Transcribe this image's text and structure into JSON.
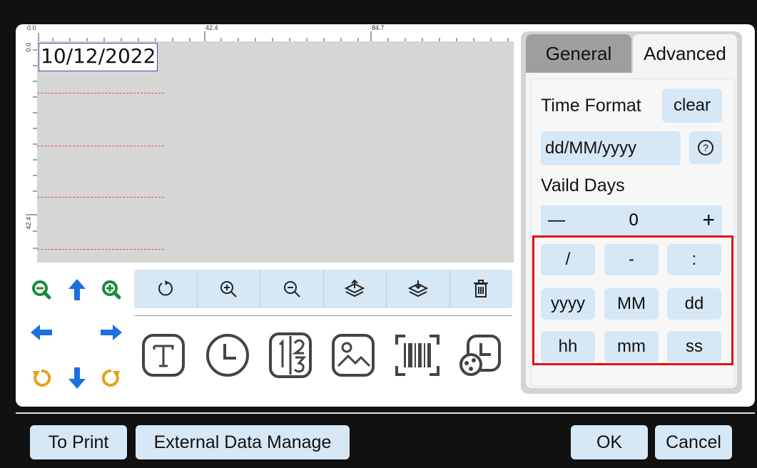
{
  "canvas": {
    "ruler_top_labels": [
      "0.0",
      "42.4",
      "84.7"
    ],
    "ruler_left_labels": [
      "0.0",
      "42.4"
    ],
    "date_text": "10/12/2022"
  },
  "toolbar": {
    "icons": [
      "rotate-icon",
      "zoom-in-icon",
      "zoom-out-icon",
      "layer-up-icon",
      "layer-down-icon",
      "trash-icon"
    ]
  },
  "navigation": {
    "icons": [
      "zoom-out-icon",
      "arrow-up-icon",
      "zoom-in-icon",
      "arrow-left-icon",
      "arrow-right-icon",
      "rotate-left-icon",
      "arrow-down-icon",
      "rotate-right-icon"
    ]
  },
  "insert_tools": {
    "icons": [
      "text-tool-icon",
      "clock-tool-icon",
      "counter-tool-icon",
      "image-tool-icon",
      "barcode-tool-icon",
      "shift-tool-icon"
    ]
  },
  "tabs": {
    "general": "General",
    "advanced": "Advanced"
  },
  "advanced": {
    "time_format_label": "Time Format",
    "clear_label": "clear",
    "format_value": "dd/MM/yyyy",
    "help_icon": "?",
    "valid_days_label": "Vaild Days",
    "valid_days_value": "0",
    "minus": "—",
    "plus": "+",
    "symbols": [
      "/",
      "-",
      ":",
      "yyyy",
      "MM",
      "dd",
      "hh",
      "mm",
      "ss"
    ]
  },
  "bottom": {
    "to_print": "To Print",
    "external_data": "External Data Manage",
    "ok": "OK",
    "cancel": "Cancel"
  },
  "colors": {
    "accent_blue": "#1b6fe0",
    "zoom_green": "#1a8a3a",
    "rotate_orange": "#e3a21a",
    "button_bg": "#d6e7f5",
    "highlight": "#e31212"
  }
}
